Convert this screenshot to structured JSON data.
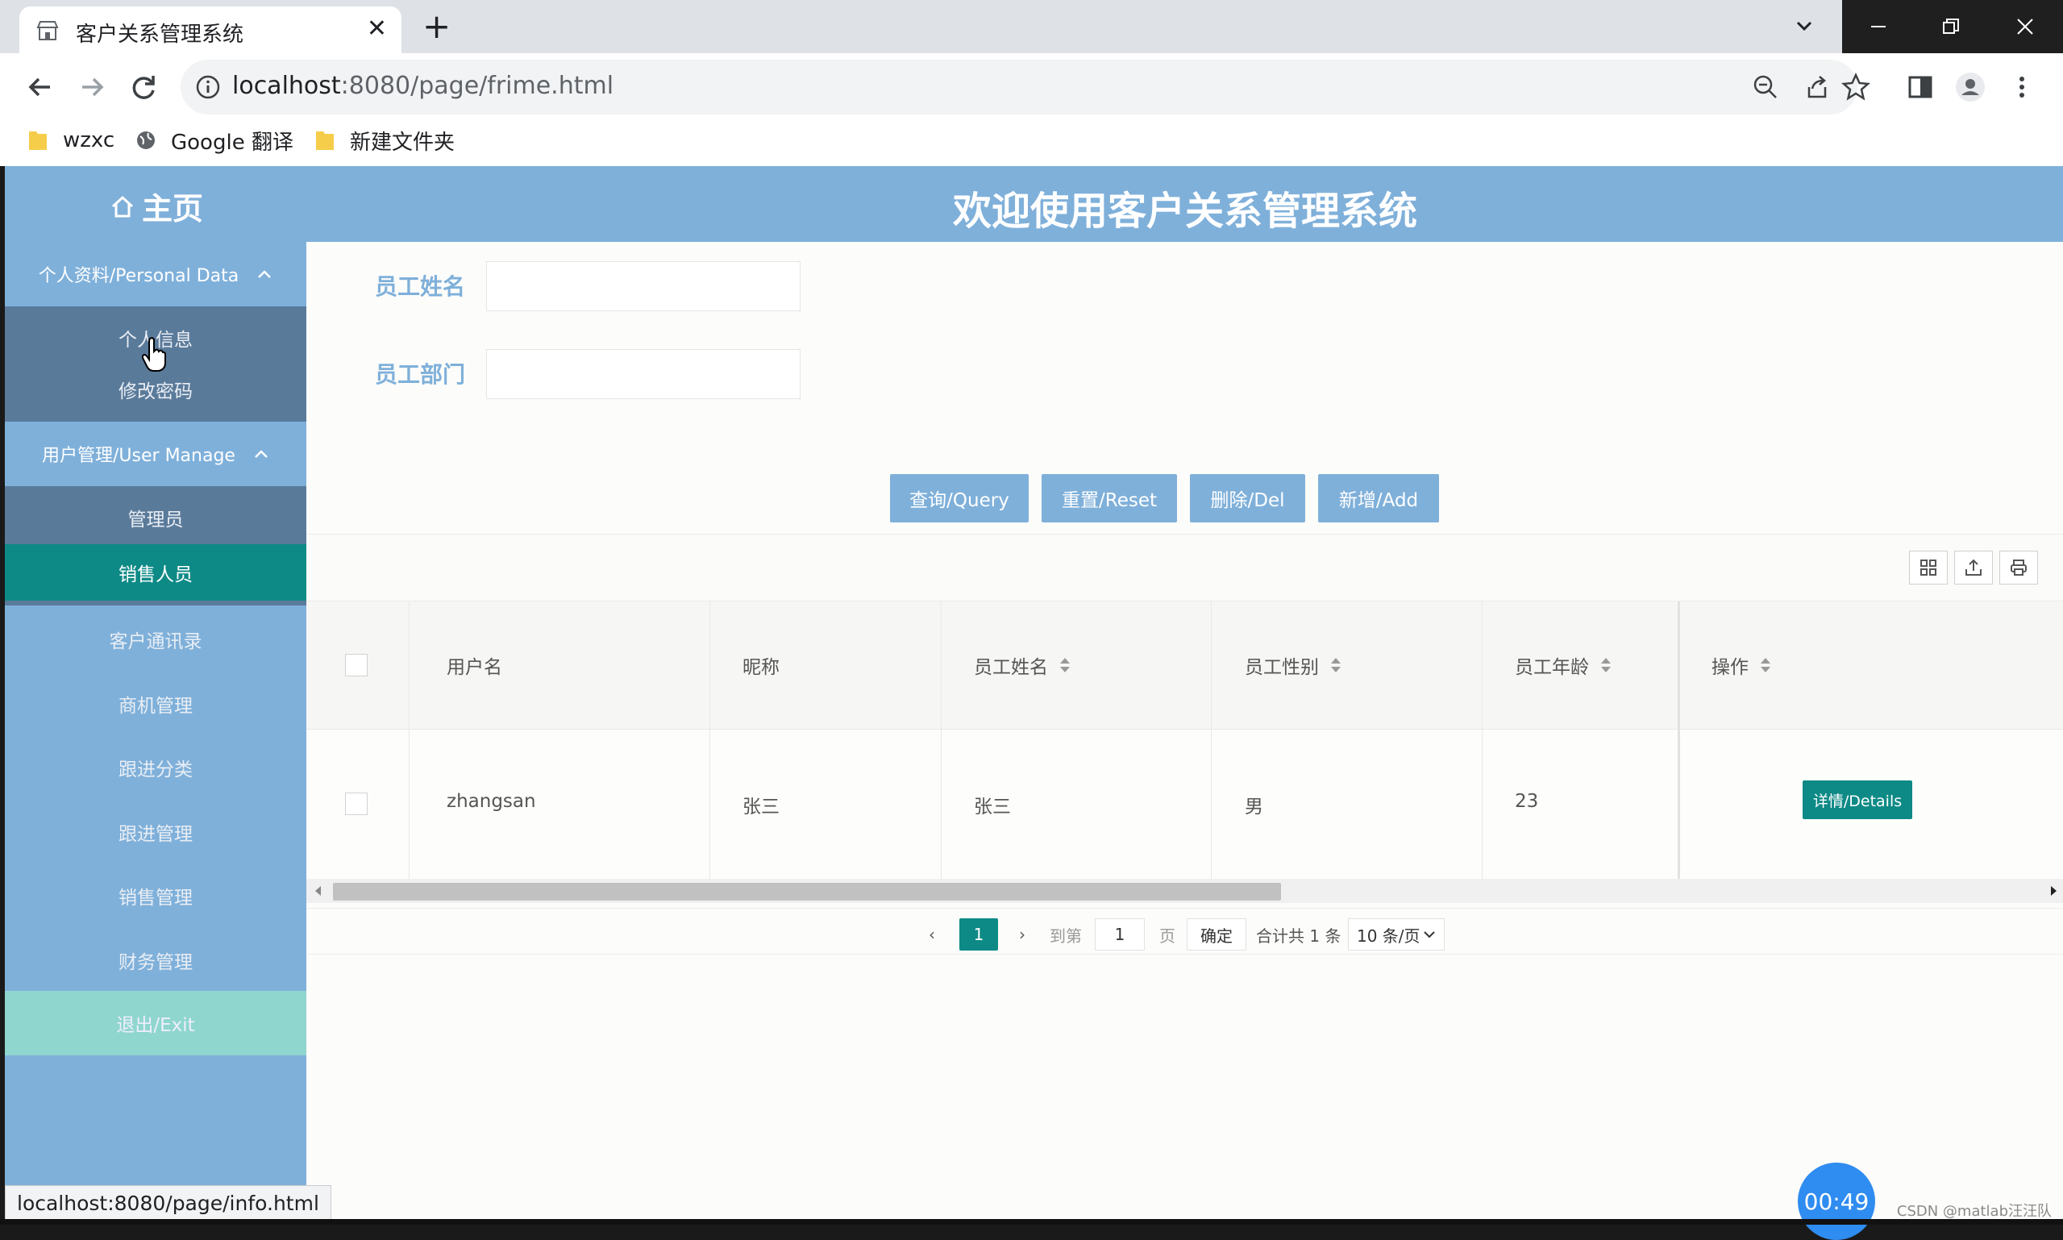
{
  "browser": {
    "tab_title": "客户关系管理系统",
    "url_host": "localhost",
    "url_rest": ":8080/page/frime.html",
    "bookmarks": [
      "wzxc",
      "Google 翻译",
      "新建文件夹"
    ]
  },
  "header": {
    "home_label": "主页",
    "title": "欢迎使用客户关系管理系统"
  },
  "sidebar": {
    "group_personal": "个人资料/Personal Data",
    "personal_items": [
      "个人信息",
      "修改密码"
    ],
    "group_user": "用户管理/User Manage",
    "user_items": [
      "管理员",
      "销售人员"
    ],
    "items": [
      "客户通讯录",
      "商机管理",
      "跟进分类",
      "跟进管理",
      "销售管理",
      "财务管理"
    ],
    "exit": "退出/Exit"
  },
  "form": {
    "name_label": "员工姓名",
    "name_value": "",
    "dept_label": "员工部门",
    "dept_value": ""
  },
  "buttons": {
    "query": "查询/Query",
    "reset": "重置/Reset",
    "delete": "删除/Del",
    "add": "新增/Add"
  },
  "table": {
    "columns": [
      "用户名",
      "昵称",
      "员工姓名",
      "员工性别",
      "员工年龄",
      "操作"
    ],
    "rows": [
      {
        "username": "zhangsan",
        "nickname": "张三",
        "name": "张三",
        "gender": "男",
        "age": "23",
        "action": "详情/Details"
      }
    ]
  },
  "pager": {
    "current": "1",
    "goto_label": "到第",
    "goto_value": "1",
    "page_label": "页",
    "confirm": "确定",
    "total": "合计共 1 条",
    "page_size": "10 条/页"
  },
  "status_url": "localhost:8080/page/info.html",
  "timer": "00:49",
  "watermark": "CSDN @matlab汪汪队",
  "colors": {
    "primary": "#7fb0da",
    "teal": "#0d8a86",
    "exit": "#8fd6cf",
    "submenu": "#5a7a9a"
  }
}
